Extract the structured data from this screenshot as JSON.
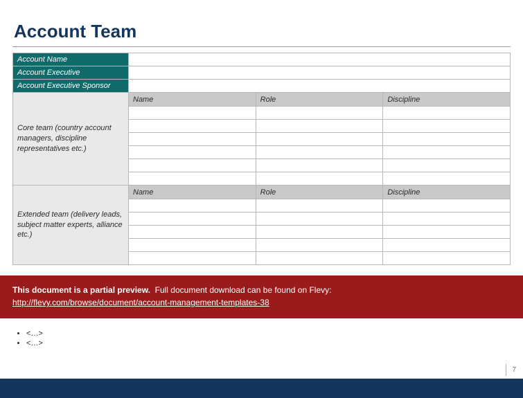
{
  "title": "Account Team",
  "label_rows": {
    "account_name": "Account Name",
    "account_executive": "Account Executive",
    "account_executive_sponsor": "Account Executive Sponsor",
    "core_team": "Core team (country account managers, discipline representatives etc.)",
    "extended_team": "Extended team (delivery leads, subject matter experts, alliance etc.)"
  },
  "columns": {
    "name": "Name",
    "role": "Role",
    "discipline": "Discipline"
  },
  "bullets": [
    "<…>",
    "<…>"
  ],
  "banner": {
    "lead": "This document is a partial preview.",
    "rest": "Full document download can be found on Flevy:",
    "link": "http://flevy.com/browse/document/account-management-templates-38"
  },
  "page_number": "7"
}
